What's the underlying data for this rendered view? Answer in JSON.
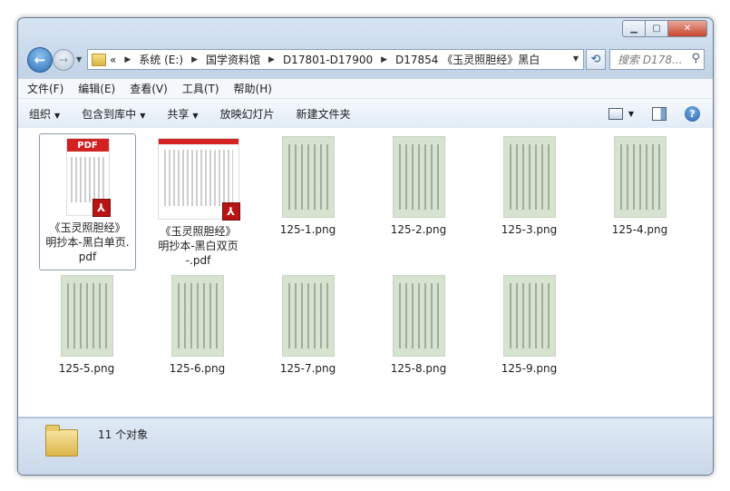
{
  "address": {
    "crumbs": [
      "系统 (E:)",
      "国学资料馆",
      "D17801-D17900",
      "D17854 《玉灵照胆经》黑白"
    ],
    "lead": "«"
  },
  "search": {
    "placeholder": "搜索 D178..."
  },
  "menu": [
    "文件(F)",
    "编辑(E)",
    "查看(V)",
    "工具(T)",
    "帮助(H)"
  ],
  "toolbar": {
    "organize": "组织",
    "include_library": "包含到库中",
    "share": "共享",
    "slideshow": "放映幻灯片",
    "new_folder": "新建文件夹"
  },
  "files": [
    {
      "line1": "《玉灵照胆经》",
      "line2": "明抄本-黑白单页.",
      "line3": "pdf"
    },
    {
      "line1": "《玉灵照胆经》",
      "line2": "明抄本-黑白双页",
      "line3": "-.pdf"
    },
    {
      "name": "125-1.png"
    },
    {
      "name": "125-2.png"
    },
    {
      "name": "125-3.png"
    },
    {
      "name": "125-4.png"
    },
    {
      "name": "125-5.png"
    },
    {
      "name": "125-6.png"
    },
    {
      "name": "125-7.png"
    },
    {
      "name": "125-8.png"
    },
    {
      "name": "125-9.png"
    }
  ],
  "pdf_badge": "PDF",
  "status": {
    "count_text": "11 个对象"
  }
}
